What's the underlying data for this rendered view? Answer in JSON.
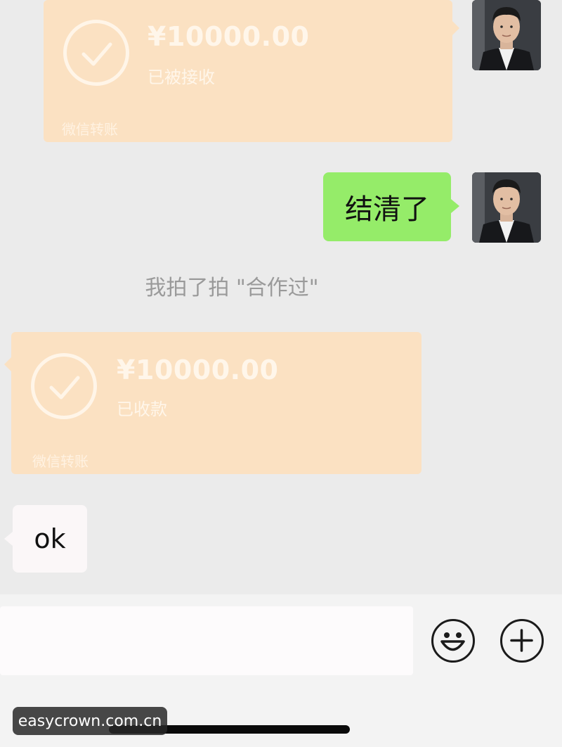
{
  "chat": {
    "transfer_1": {
      "amount": "¥10000.00",
      "status": "已被接收",
      "footer": "微信转账"
    },
    "message_green": "结清了",
    "system_message": "我拍了拍 \"合作过\"",
    "transfer_2": {
      "amount": "¥10000.00",
      "status": "已收款",
      "footer": "微信转账"
    },
    "message_white": "ok"
  },
  "input_bar": {
    "emoji_icon": "smiley-face",
    "plus_icon": "plus-circle"
  },
  "watermark": "easycrown.com.cn",
  "colors": {
    "background": "#ebebeb",
    "transfer_card": "#fbe1c2",
    "green_bubble": "#95ec69",
    "white_bubble": "#fbf7f8",
    "system_text": "#9a9a9a"
  }
}
